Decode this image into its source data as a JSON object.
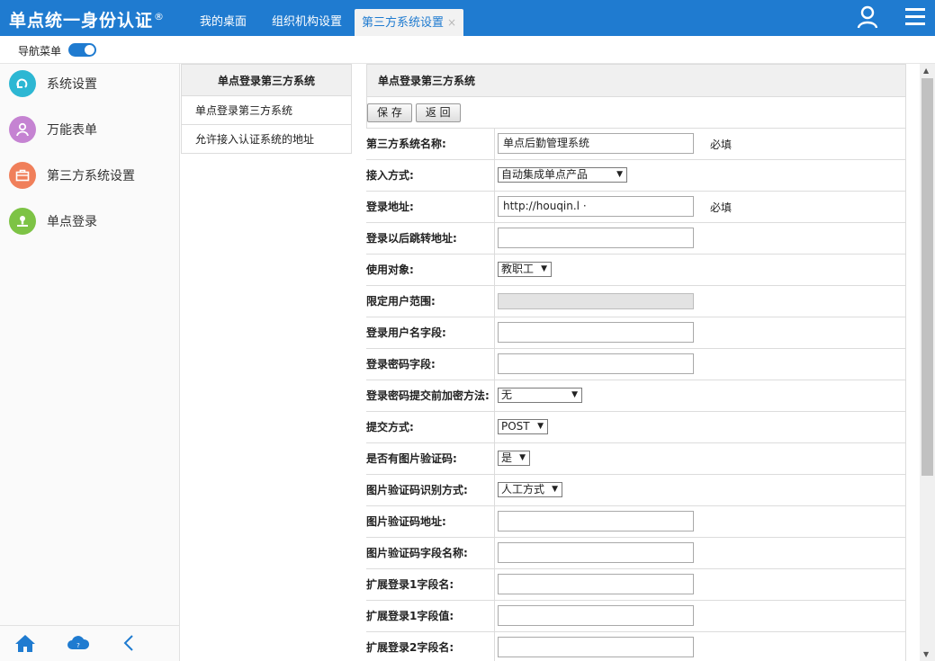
{
  "header": {
    "brand": "单点统一身份认证",
    "brand_mark": "®",
    "tabs": [
      {
        "label": "我的桌面"
      },
      {
        "label": "组织机构设置"
      },
      {
        "label": "第三方系统设置",
        "close": "×"
      }
    ]
  },
  "navbar": {
    "label": "导航菜单"
  },
  "sidebar": {
    "items": [
      {
        "label": "系统设置",
        "color": "#2db7d3",
        "icon": "gear-arrow-icon"
      },
      {
        "label": "万能表单",
        "color": "#c583d2",
        "icon": "user-icon"
      },
      {
        "label": "第三方系统设置",
        "color": "#f07f5a",
        "icon": "briefcase-icon"
      },
      {
        "label": "单点登录",
        "color": "#7dc345",
        "icon": "person-login-icon"
      }
    ],
    "bottom_icons": [
      "home-icon",
      "cloud-help-icon",
      "collapse-left-icon"
    ]
  },
  "midpanel": {
    "title": "单点登录第三方系统",
    "items": [
      {
        "label": "单点登录第三方系统"
      },
      {
        "label": "允许接入认证系统的地址"
      }
    ]
  },
  "form": {
    "title": "单点登录第三方系统",
    "buttons": {
      "save": "保 存",
      "back": "返 回"
    },
    "required_label": "必填",
    "rows": {
      "r0": {
        "label": "第三方系统名称:",
        "value": "单点后勤管理系统"
      },
      "r1": {
        "label": "接入方式:",
        "value": "自动集成单点产品"
      },
      "r2": {
        "label": "登录地址:",
        "value": "http://houqin.l    ·   "
      },
      "r3": {
        "label": "登录以后跳转地址:",
        "value": ""
      },
      "r4": {
        "label": "使用对象:",
        "value": "教职工"
      },
      "r5": {
        "label": "限定用户范围:",
        "value": ""
      },
      "r6": {
        "label": "登录用户名字段:",
        "value": ""
      },
      "r7": {
        "label": "登录密码字段:",
        "value": ""
      },
      "r8": {
        "label": "登录密码提交前加密方法:",
        "value": "无"
      },
      "r9": {
        "label": "提交方式:",
        "value": "POST"
      },
      "r10": {
        "label": "是否有图片验证码:",
        "value": "是"
      },
      "r11": {
        "label": "图片验证码识别方式:",
        "value": "人工方式"
      },
      "r12": {
        "label": "图片验证码地址:",
        "value": ""
      },
      "r13": {
        "label": "图片验证码字段名称:",
        "value": ""
      },
      "r14": {
        "label": "扩展登录1字段名:",
        "value": ""
      },
      "r15": {
        "label": "扩展登录1字段值:",
        "value": ""
      },
      "r16": {
        "label": "扩展登录2字段名:",
        "value": ""
      }
    }
  },
  "colors": {
    "accent": "#1f7bd0"
  }
}
